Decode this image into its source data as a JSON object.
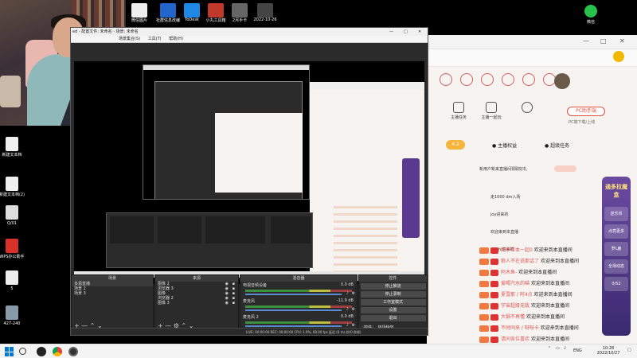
{
  "desktop": {
    "top_icons": [
      {
        "label": "微信图片",
        "color": "#eeeeee"
      },
      {
        "label": "社群信息改编",
        "color": "#2266cc"
      },
      {
        "label": "ToDesk",
        "color": "#1e88e5"
      },
      {
        "label": "小丸工具箱",
        "color": "#c0392b"
      },
      {
        "label": "2月手卡",
        "color": "#666666"
      },
      {
        "label": "2022-10-26",
        "color": "#444444"
      }
    ],
    "left_icons": [
      "新建文本档",
      "新建文本档(2)",
      "Q/01",
      "WPS办公助手",
      "5",
      "427-240"
    ],
    "wechat_label": "微信"
  },
  "obs": {
    "window_title": "ed - 配置文件: 未命名 - 场景: 未命名",
    "menu": [
      "场景集合(S)",
      "工具(T)",
      "帮助(H)"
    ],
    "docks": {
      "scenes": {
        "title": "场景",
        "items": [
          "多源直播",
          "场景 2",
          "场景 3"
        ]
      },
      "sources": {
        "title": "来源",
        "items": [
          "图像 2",
          "浏览器 3",
          "图像",
          "浏览器 2",
          "图像 3"
        ]
      },
      "mixer": {
        "title": "混音器",
        "tracks": [
          {
            "name": "电视音频设备",
            "db": "0.0 dB"
          },
          {
            "name": "麦克风",
            "db": "-11.9 dB"
          },
          {
            "name": "麦克风 2",
            "db": "0.0 dB"
          }
        ]
      },
      "controls": {
        "title": "控件",
        "buttons": [
          "停止推流",
          "停止录制",
          "工作室模式",
          "设置",
          "退出"
        ],
        "tabs": [
          "控件",
          "转场特效"
        ]
      }
    },
    "status": "LIVE: 00:00:00   REC: 00:00:00   CPU: 1.9%, 60.00 fps   延迟 (0 ms 秒/0 秒帧)"
  },
  "browser": {
    "win_controls": [
      "—",
      "□",
      "✕"
    ],
    "nav_labels": [
      "主播任务",
      "主播一起玩",
      "直播",
      "PC助手"
    ],
    "pc_button": "PC助手端",
    "pc_sub": "PC端下载/上线",
    "tabs": [
      "主播权益",
      "超级任务"
    ],
    "chip": "4.2",
    "section_hint": "新用户新来直播间领取好礼",
    "banner_top": "通多拉魔盒",
    "banner_list": [
      "逆乐币",
      "点亮更多",
      "罗L鹿",
      "全场动态",
      "0/52"
    ],
    "side_lines": [
      "走1000 dm入场",
      "joy进来的",
      "欢迎来到本直播",
      "wcyhi进来的"
    ],
    "messages": [
      {
        "user": "雨季带本一起0",
        "text": "欢迎来到本直播间"
      },
      {
        "user": "狼人不在说那话了",
        "text": "欢迎来到本直播间"
      },
      {
        "user": "阿木鱼-",
        "text": "欢迎来到本直播间"
      },
      {
        "user": "爱喝汽水的喵",
        "text": "欢迎来到本直播间"
      },
      {
        "user": "夏雪那 / 阿4点",
        "text": "欢迎来到本直播间"
      },
      {
        "user": "宇宙超级无敌",
        "text": "欢迎来到本直播间"
      },
      {
        "user": "大锅不再懂",
        "text": "欢迎来到本直播间"
      },
      {
        "user": "不时同来 / 呀呀卡",
        "text": "欢迎来到本直播间"
      },
      {
        "user": "请问各位喜欢",
        "text": "欢迎来到本直播间"
      }
    ]
  },
  "taskbar": {
    "lang": "ENG",
    "time": "10:28",
    "date": "2022/10/27"
  },
  "colors": {
    "accent": "#e0523a",
    "obs_bg": "#2b2b2b"
  }
}
